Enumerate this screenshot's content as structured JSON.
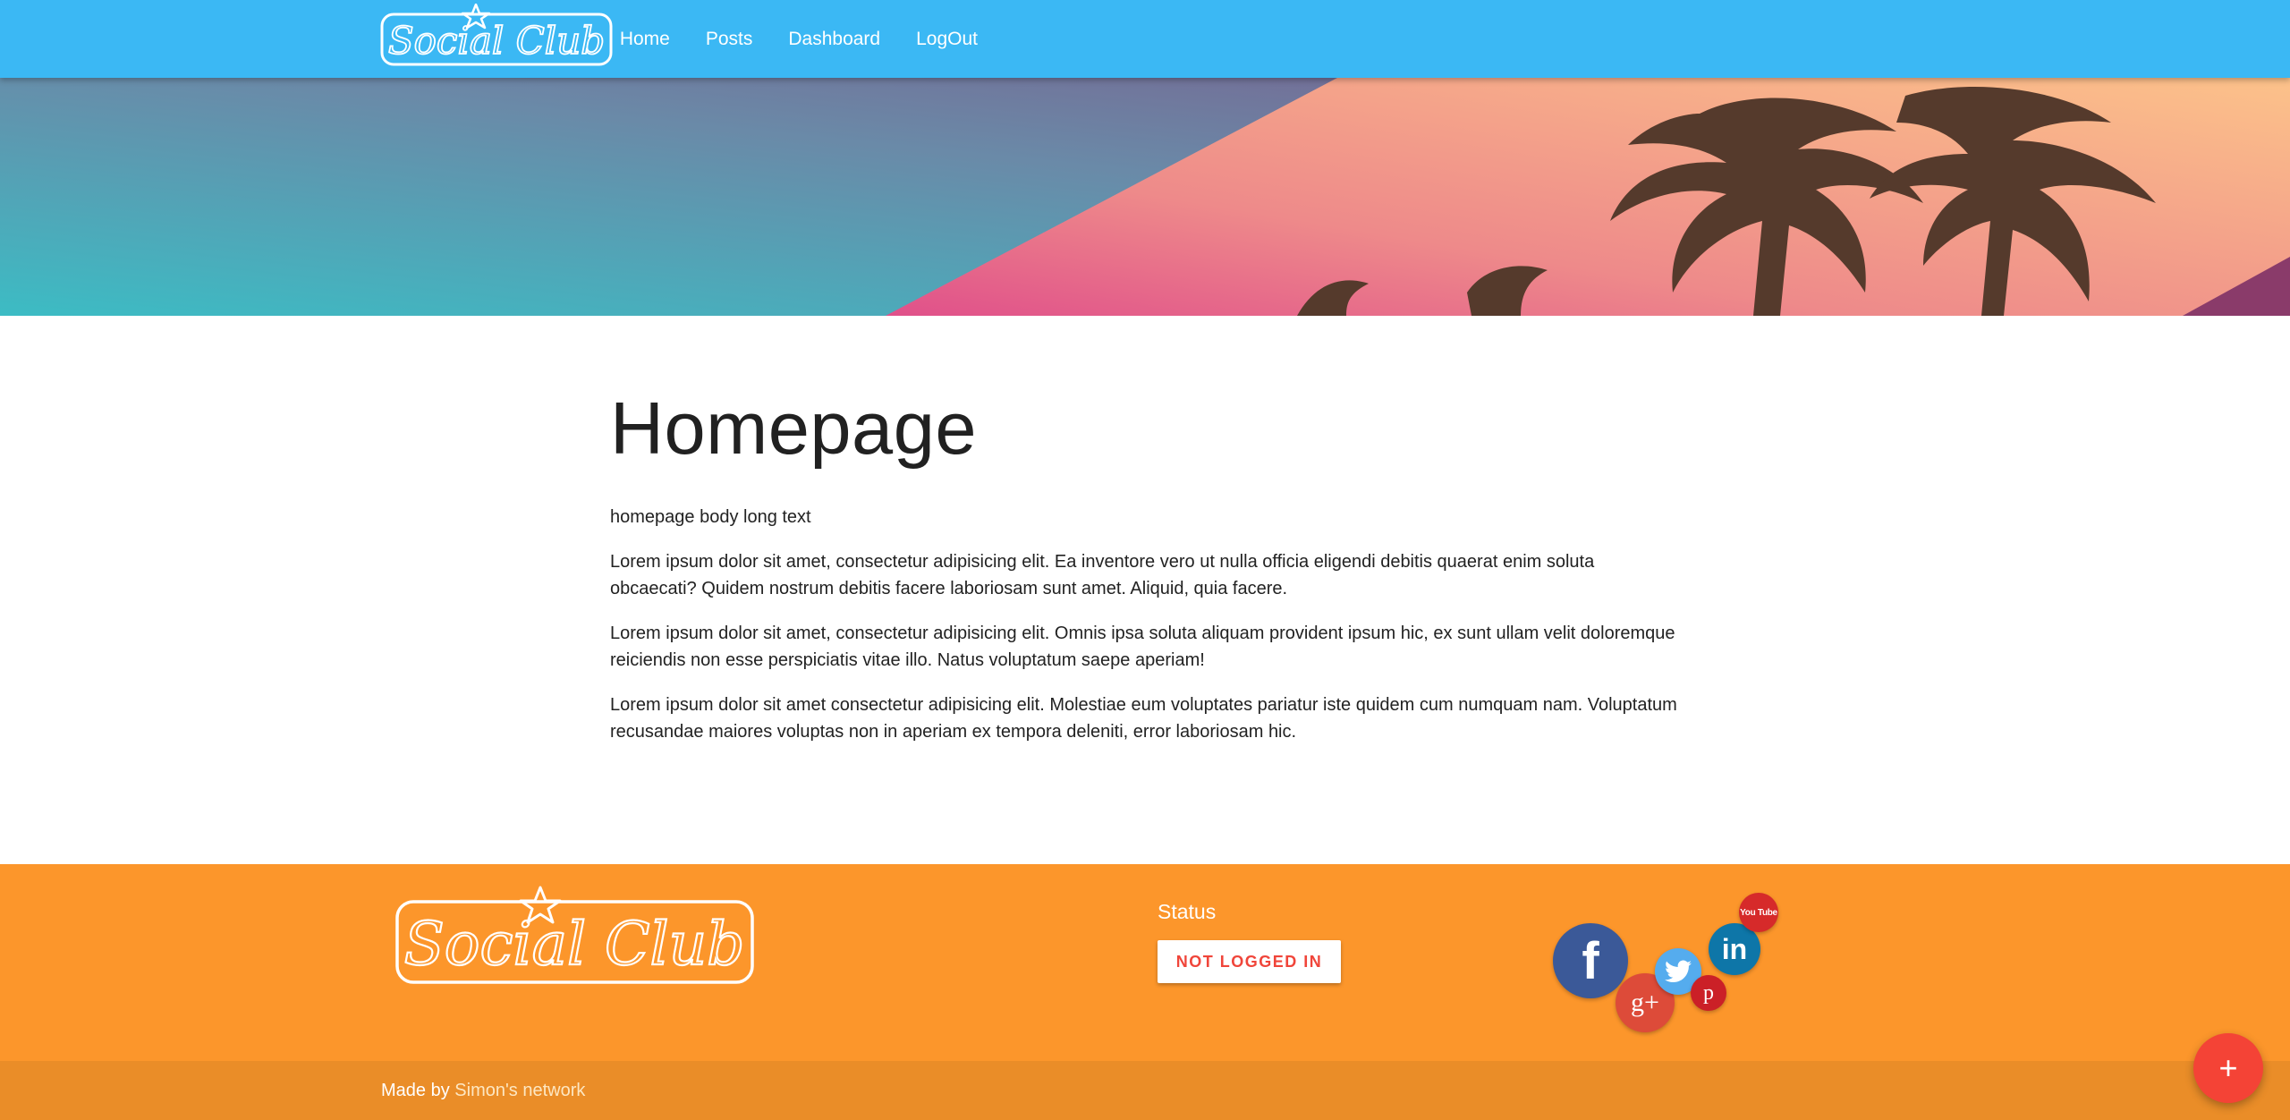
{
  "brand": {
    "logo_text": "Social Club"
  },
  "nav": {
    "items": [
      {
        "label": "Home"
      },
      {
        "label": "Posts"
      },
      {
        "label": "Dashboard"
      },
      {
        "label": "LogOut"
      }
    ]
  },
  "main": {
    "title": "Homepage",
    "intro": "homepage body long text",
    "paragraphs": [
      "Lorem ipsum dolor sit amet, consectetur adipisicing elit. Ea inventore vero ut nulla officia eligendi debitis quaerat enim soluta obcaecati? Quidem nostrum debitis facere laboriosam sunt amet. Aliquid, quia facere.",
      "Lorem ipsum dolor sit amet, consectetur adipisicing elit. Omnis ipsa soluta aliquam provident ipsum hic, ex sunt ullam velit doloremque reiciendis non esse perspiciatis vitae illo. Natus voluptatum saepe aperiam!",
      "Lorem ipsum dolor sit amet consectetur adipisicing elit. Molestiae eum voluptates pariatur iste quidem cum numquam nam. Voluptatum recusandae maiores voluptas non in aperiam ex tempora deleniti, error laboriosam hic."
    ]
  },
  "footer": {
    "status_title": "Status",
    "status_badge": "NOT LOGGED IN",
    "socials": {
      "facebook": "f",
      "googleplus": "g+",
      "twitter": "twitter-bird-icon",
      "linkedin": "in",
      "pinterest": "p",
      "youtube": "You Tube"
    },
    "made_by": "Made by",
    "author_link": "Simon's network"
  },
  "fab": {
    "label": "+"
  },
  "colors": {
    "nav": "#3bb8f4",
    "footer": "#fc962b",
    "footer_bottom": "#ea8d28",
    "status_text": "#f0453a",
    "fab": "#f44336"
  }
}
